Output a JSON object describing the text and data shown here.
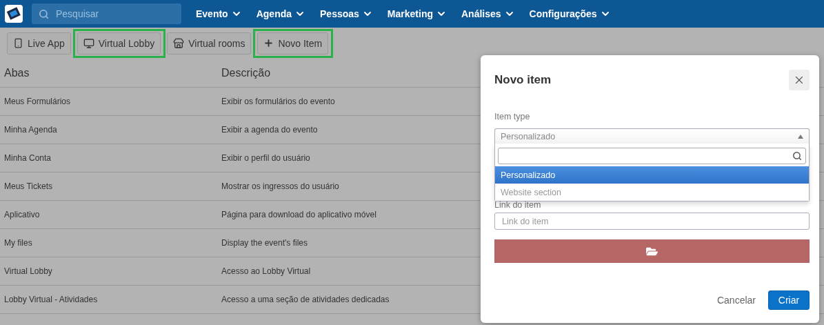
{
  "navbar": {
    "search": {
      "placeholder": "Pesquisar"
    },
    "menus": [
      "Evento",
      "Agenda",
      "Pessoas",
      "Marketing",
      "Análises",
      "Configurações"
    ]
  },
  "toolbar": [
    {
      "label": "Live App",
      "highlighted": false
    },
    {
      "label": "Virtual Lobby",
      "highlighted": true
    },
    {
      "label": "Virtual rooms",
      "highlighted": false
    },
    {
      "label": "Novo Item",
      "highlighted": true
    }
  ],
  "table": {
    "columns": [
      "Abas",
      "Descrição"
    ],
    "rows": [
      [
        "Meus Formulários",
        "Exibir os formulários do evento"
      ],
      [
        "Minha Agenda",
        "Exibir a agenda do evento"
      ],
      [
        "Minha Conta",
        "Exibir o perfil do usuário"
      ],
      [
        "Meus Tickets",
        "Mostrar os ingressos do usuário"
      ],
      [
        "Aplicativo",
        "Página para download do aplicativo móvel"
      ],
      [
        "My files",
        "Display the event's files"
      ],
      [
        "Virtual Lobby",
        "Acesso ao Lobby Virtual"
      ],
      [
        "Lobby Virtual - Atividades",
        "Acesso a uma seção de atividades dedicadas"
      ]
    ]
  },
  "modal": {
    "title": "Novo item",
    "item_type": {
      "label": "Item type",
      "value": "Personalizado",
      "expanded": true,
      "options": [
        {
          "label": "Personalizado",
          "selected": true
        },
        {
          "label": "Website section",
          "selected": false
        }
      ]
    },
    "link": {
      "label": "Link do item",
      "placeholder": "Link do item"
    },
    "buttons": {
      "cancel": "Cancelar",
      "create": "Criar"
    }
  }
}
